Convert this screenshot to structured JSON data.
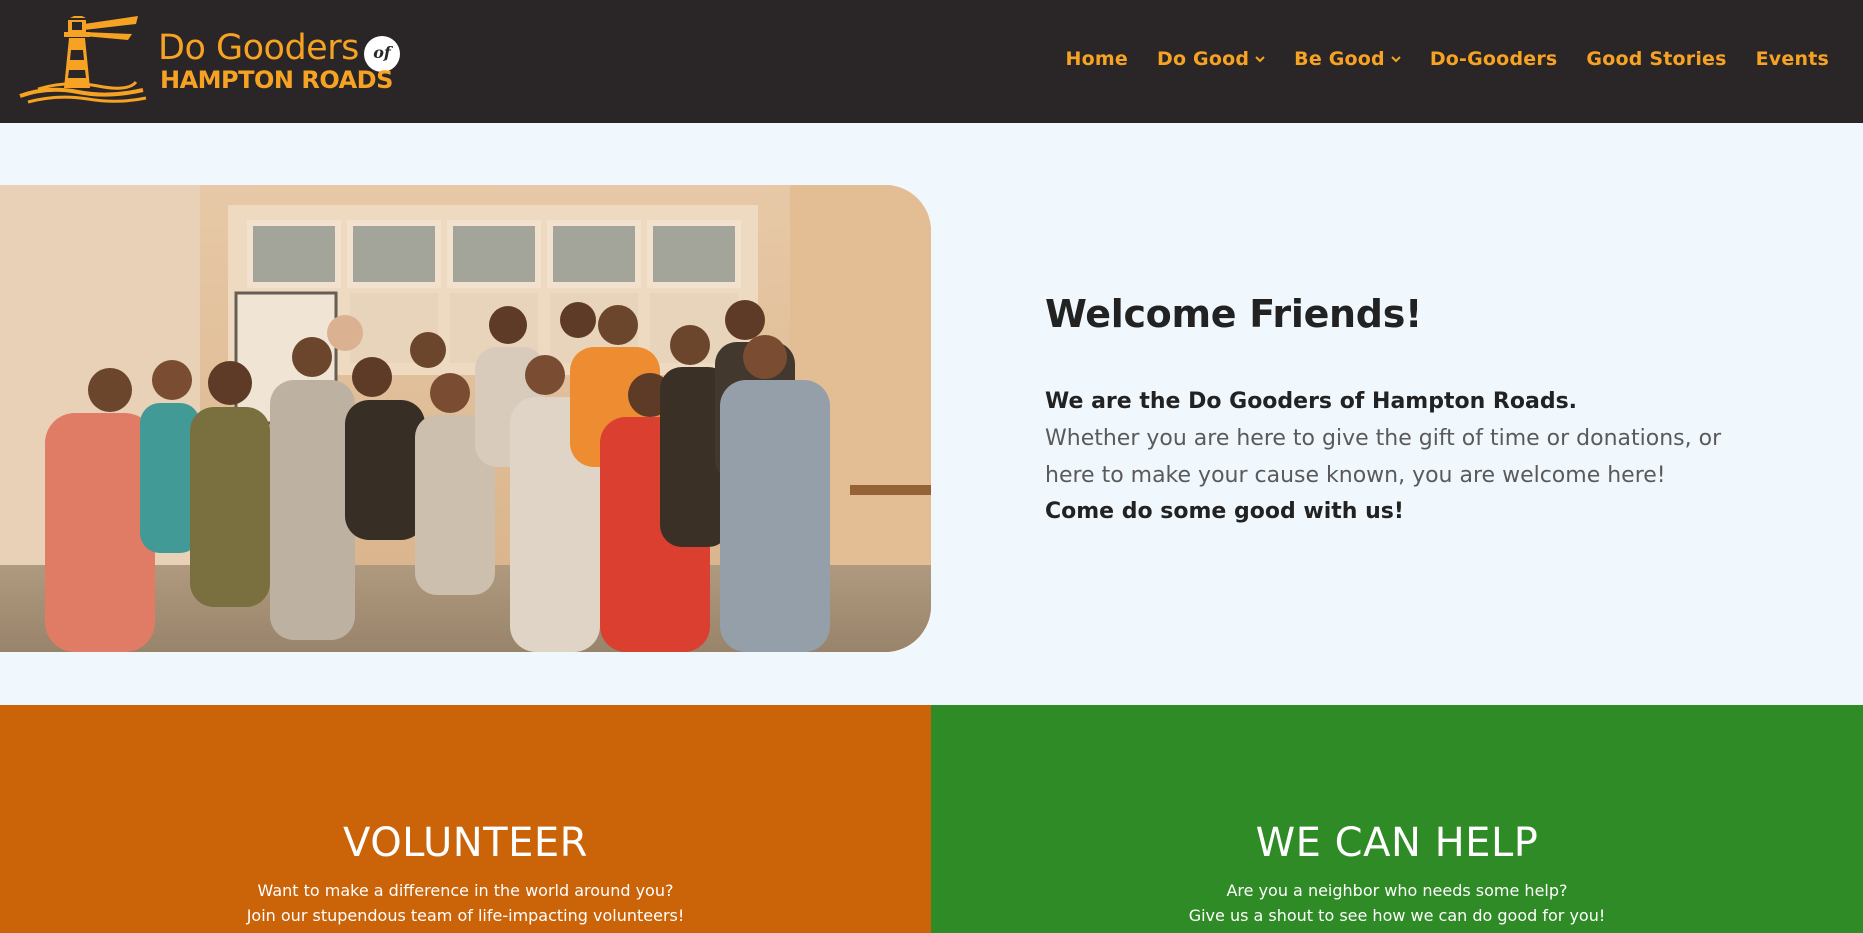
{
  "colors": {
    "header_bg": "#2a2526",
    "brand_orange": "#f6a324",
    "page_bg": "#f1f8fd",
    "volunteer_bg": "#cb6309",
    "help_bg": "#2f8b26"
  },
  "logo": {
    "line1": "Do Gooders",
    "of": "of",
    "line2": "HAMPTON ROADS",
    "icon": "lighthouse-icon"
  },
  "nav": {
    "items": [
      {
        "label": "Home"
      },
      {
        "label": "Do Good",
        "has_dropdown": true
      },
      {
        "label": "Be Good",
        "has_dropdown": true
      },
      {
        "label": "Do-Gooders"
      },
      {
        "label": "Good Stories"
      },
      {
        "label": "Events"
      }
    ]
  },
  "hero": {
    "photo_alt": "group-photo",
    "title": "Welcome Friends!",
    "intro_bold": "We are the Do Gooders of Hampton Roads.",
    "body": "Whether you are here to give the gift of time or donations, or here to make your cause known, you are welcome here!",
    "closing_bold": "Come do some good with us!"
  },
  "volunteer": {
    "title": "VOLUNTEER",
    "line1": "Want to make a difference in the world around you?",
    "line2": "Join our stupendous team of life-impacting volunteers!"
  },
  "help": {
    "title": "WE CAN HELP",
    "line1": "Are you a neighbor who needs some help?",
    "line2": "Give us a shout to see how we can do good for you!"
  }
}
